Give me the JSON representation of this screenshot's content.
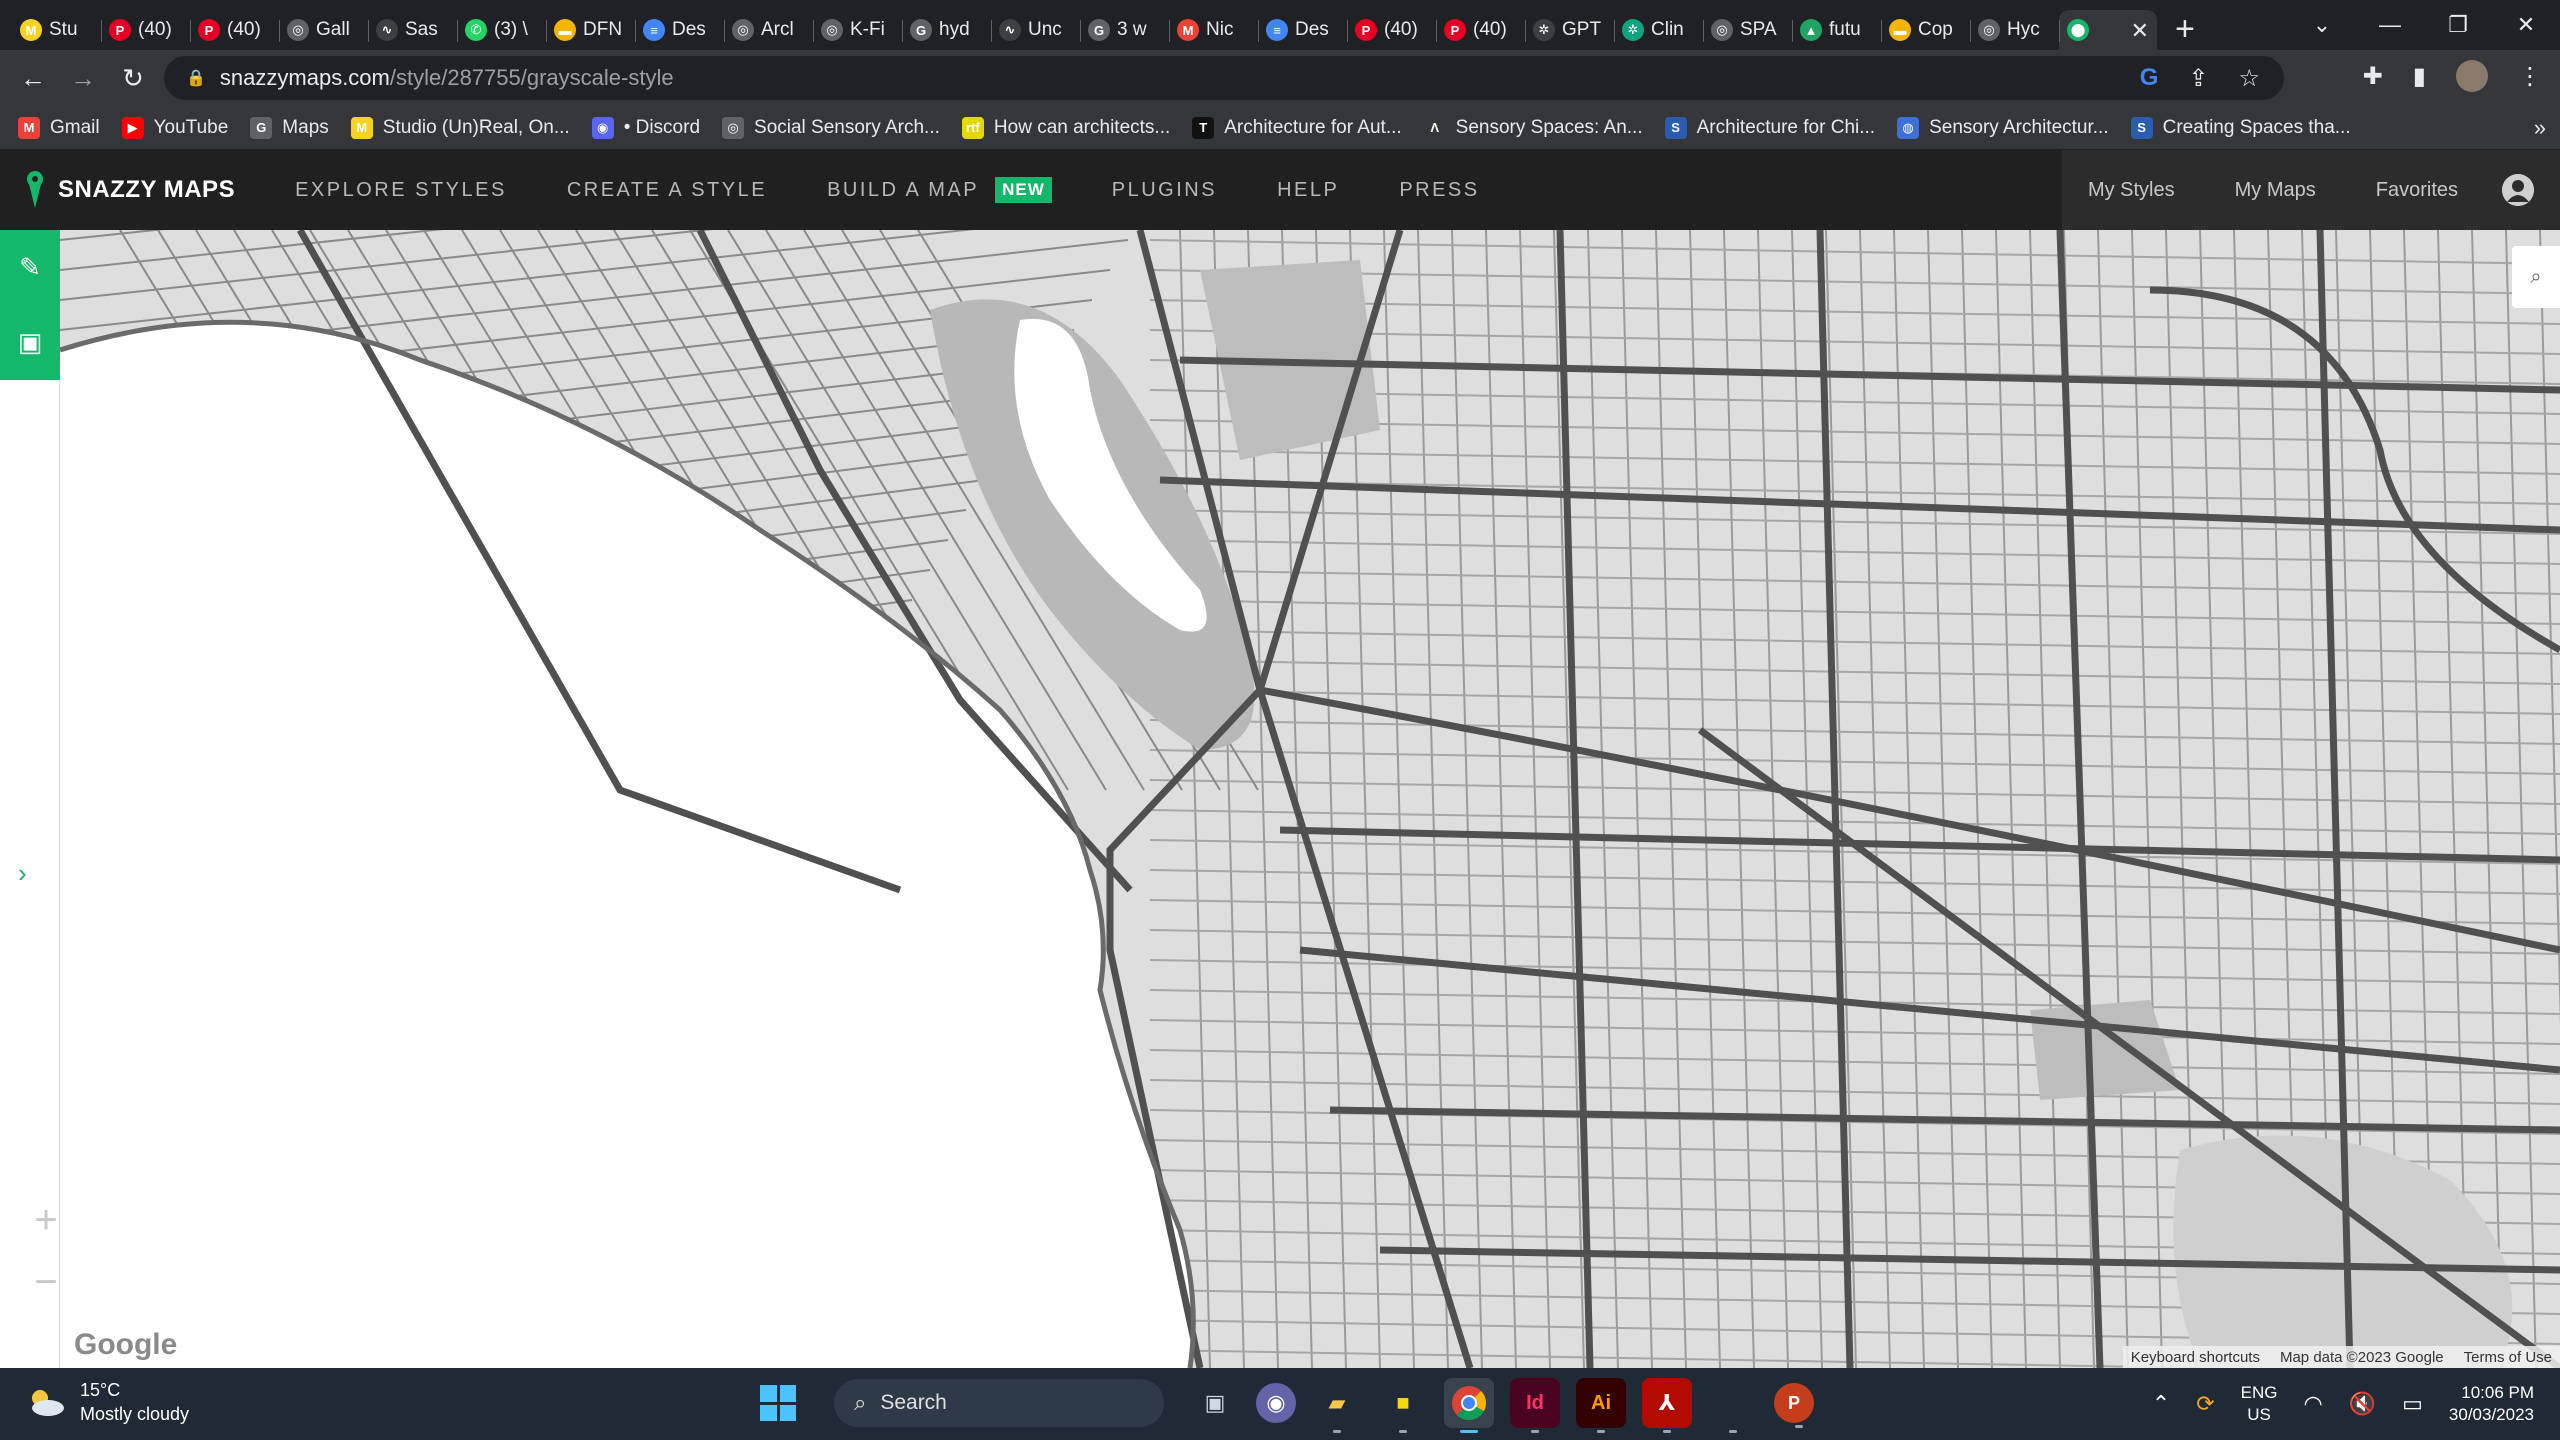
{
  "browser": {
    "tabs": [
      {
        "title": "Stu",
        "icon": "miro-icon",
        "color": "#f7d21e"
      },
      {
        "title": "(40)",
        "icon": "pinterest-icon",
        "color": "#e60023"
      },
      {
        "title": "(40)",
        "icon": "pinterest-icon",
        "color": "#e60023"
      },
      {
        "title": "Gall",
        "icon": "archdaily-icon",
        "color": "#5f6368"
      },
      {
        "title": "Sas",
        "icon": "web-icon",
        "color": "#3c4043"
      },
      {
        "title": "(3) \\",
        "icon": "whatsapp-icon",
        "color": "#25d366"
      },
      {
        "title": "DFN",
        "icon": "slides-icon",
        "color": "#f4b400"
      },
      {
        "title": "Des",
        "icon": "docs-icon",
        "color": "#4285f4"
      },
      {
        "title": "Arcl",
        "icon": "archdaily-icon",
        "color": "#5f6368"
      },
      {
        "title": "K-Fi",
        "icon": "archdaily-icon",
        "color": "#5f6368"
      },
      {
        "title": "hyd",
        "icon": "google-icon",
        "color": "#5f6368"
      },
      {
        "title": "Unc",
        "icon": "web-icon",
        "color": "#3c4043"
      },
      {
        "title": "3 w",
        "icon": "google-icon",
        "color": "#5f6368"
      },
      {
        "title": "Nic",
        "icon": "gmail-icon",
        "color": "#ea4335"
      },
      {
        "title": "Des",
        "icon": "docs-icon",
        "color": "#4285f4"
      },
      {
        "title": "(40)",
        "icon": "pinterest-icon",
        "color": "#e60023"
      },
      {
        "title": "(40)",
        "icon": "pinterest-icon",
        "color": "#e60023"
      },
      {
        "title": "GPT",
        "icon": "openai-icon",
        "color": "#3c4043"
      },
      {
        "title": "Clin",
        "icon": "chatgpt-icon",
        "color": "#10a37f"
      },
      {
        "title": "SPA",
        "icon": "archdaily-icon",
        "color": "#5f6368"
      },
      {
        "title": "futu",
        "icon": "drive-icon",
        "color": "#1fa463"
      },
      {
        "title": "Cop",
        "icon": "slides-icon",
        "color": "#f4b400"
      },
      {
        "title": "Hyc",
        "icon": "archdaily-icon",
        "color": "#5f6368"
      },
      {
        "title": "",
        "icon": "maps-pin-icon",
        "color": "#15b86b",
        "active": true
      }
    ],
    "url_host": "snazzymaps.com",
    "url_path": "/style/287755/grayscale-style",
    "bookmarks": [
      {
        "label": "Gmail",
        "icon": "gmail-icon",
        "color": "#ea4335"
      },
      {
        "label": "YouTube",
        "icon": "youtube-icon",
        "color": "#ff0000"
      },
      {
        "label": "Maps",
        "icon": "google-icon",
        "color": "#5f6368"
      },
      {
        "label": "Studio (Un)Real, On...",
        "icon": "miro-icon",
        "color": "#f7d21e"
      },
      {
        "label": "• Discord",
        "icon": "discord-icon",
        "color": "#5865f2"
      },
      {
        "label": "Social Sensory Arch...",
        "icon": "archdaily-icon",
        "color": "#5f6368"
      },
      {
        "label": "How can architects...",
        "icon": "rtf-icon",
        "color": "#e5d800"
      },
      {
        "label": "Architecture for Aut...",
        "icon": "t-icon",
        "color": "#111111"
      },
      {
        "label": "Sensory Spaces: An...",
        "icon": "lambda-icon",
        "color": "#35363a"
      },
      {
        "label": "Architecture for Chi...",
        "icon": "s-icon",
        "color": "#2a5db0"
      },
      {
        "label": "Sensory Architectur...",
        "icon": "globe-icon",
        "color": "#3d6fd8"
      },
      {
        "label": "Creating Spaces tha...",
        "icon": "s-icon",
        "color": "#2a5db0"
      }
    ]
  },
  "site": {
    "logo_text": "SNAZZY MAPS",
    "nav": [
      {
        "label": "EXPLORE STYLES"
      },
      {
        "label": "CREATE A STYLE"
      },
      {
        "label": "BUILD A MAP",
        "badge": "NEW"
      },
      {
        "label": "PLUGINS"
      },
      {
        "label": "HELP"
      },
      {
        "label": "PRESS"
      }
    ],
    "user_nav": [
      "My Styles",
      "My Maps",
      "Favorites"
    ],
    "accent_color": "#15b86b"
  },
  "map": {
    "attribution": [
      "Keyboard shortcuts",
      "Map data ©2023 Google",
      "Terms of Use"
    ],
    "google_logo": "Google",
    "zoom_in": "+",
    "zoom_out": "−"
  },
  "taskbar": {
    "weather_temp": "15°C",
    "weather_desc": "Mostly cloudy",
    "search_label": "Search",
    "lang_top": "ENG",
    "lang_bottom": "US",
    "time": "10:06 PM",
    "date": "30/03/2023"
  }
}
